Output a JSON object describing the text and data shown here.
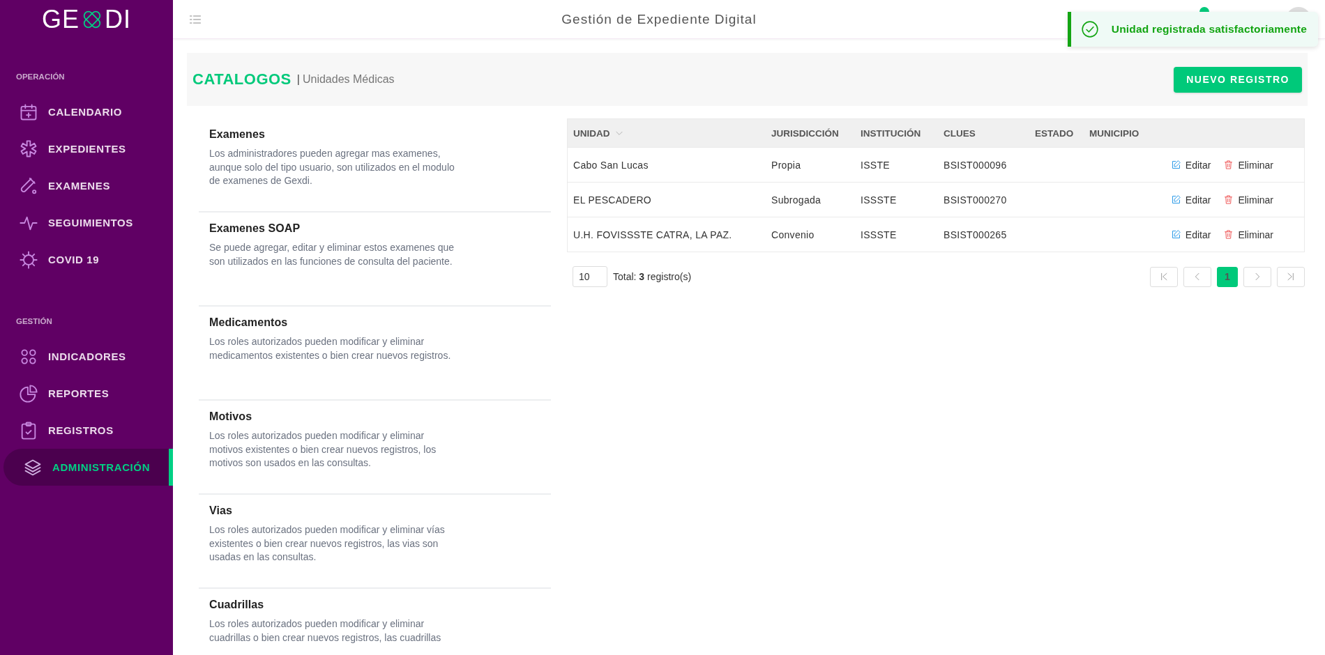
{
  "sidebar": {
    "logo": {
      "left": "GE",
      "right": "DI"
    },
    "sections": [
      {
        "title": "OPERACIÓN",
        "items": [
          {
            "label": "CALENDARIO",
            "selected": false
          },
          {
            "label": "EXPEDIENTES",
            "selected": false
          },
          {
            "label": "EXAMENES",
            "selected": false
          },
          {
            "label": "SEGUIMIENTOS",
            "selected": false
          },
          {
            "label": "COVID 19",
            "selected": false
          }
        ]
      },
      {
        "title": "GESTIÓN",
        "items": [
          {
            "label": "INDICADORES",
            "selected": false
          },
          {
            "label": "REPORTES",
            "selected": false
          },
          {
            "label": "REGISTROS",
            "selected": false
          },
          {
            "label": "ADMINISTRACIÓN",
            "selected": true
          }
        ]
      }
    ]
  },
  "header": {
    "title": "Gestión de Expediente Digital"
  },
  "toast": {
    "message": "Unidad registrada satisfactoriamente"
  },
  "breadcrumb": {
    "section": "CATALOGOS",
    "separator": "|",
    "page": "Unidades Médicas",
    "button": "NUEVO REGISTRO"
  },
  "catalogs": [
    {
      "title": "Examenes",
      "description": "Los administradores pueden agregar mas examenes, aunque solo del tipo usuario, son utilizados en el modulo de examenes de Gexdi."
    },
    {
      "title": "Examenes SOAP",
      "description": "Se puede agregar, editar y eliminar estos examenes que son utilizados en las funciones de consulta del paciente."
    },
    {
      "title": "Medicamentos",
      "description": "Los roles autorizados pueden modificar y eliminar medicamentos existentes o bien crear nuevos registros."
    },
    {
      "title": "Motivos",
      "description": "Los roles autorizados pueden modificar y eliminar motivos existentes o bien crear nuevos registros, los motivos son usados en las consultas."
    },
    {
      "title": "Vias",
      "description": "Los roles autorizados pueden modificar y eliminar vías existentes o bien crear nuevos registros, las vias son usadas en las consultas."
    },
    {
      "title": "Cuadrillas",
      "description": "Los roles autorizados pueden modificar y eliminar cuadrillas o bien crear nuevos registros, las cuadrillas"
    }
  ],
  "table": {
    "columns": [
      {
        "label": "UNIDAD",
        "sort_icon": true
      },
      {
        "label": "JURISDICCIÓN",
        "sort_icon": false
      },
      {
        "label": "INSTITUCIÓN",
        "sort_icon": false
      },
      {
        "label": "CLUES",
        "sort_icon": false
      },
      {
        "label": "ESTADO",
        "sort_icon": false
      },
      {
        "label": "MUNICIPIO",
        "sort_icon": false
      }
    ],
    "rows": [
      {
        "cells": [
          "Cabo San Lucas",
          "Propia",
          "ISSTE",
          "BSIST000096"
        ],
        "actions": [
          "Editar",
          "Eliminar"
        ]
      },
      {
        "cells": [
          "EL PESCADERO",
          "Subrogada",
          "ISSSTE",
          "BSIST000270"
        ],
        "actions": [
          "Editar",
          "Eliminar"
        ]
      },
      {
        "cells": [
          "U.H. FOVISSSTE CATRA, LA PAZ.",
          "Convenio",
          "ISSSTE",
          "BSIST000265"
        ],
        "actions": [
          "Editar",
          "Eliminar"
        ]
      }
    ]
  },
  "pagination": {
    "page_size": "10",
    "total": "Total:  **3** registro(s)",
    "pages": [
      {
        "label": "1",
        "selected": true
      }
    ]
  }
}
